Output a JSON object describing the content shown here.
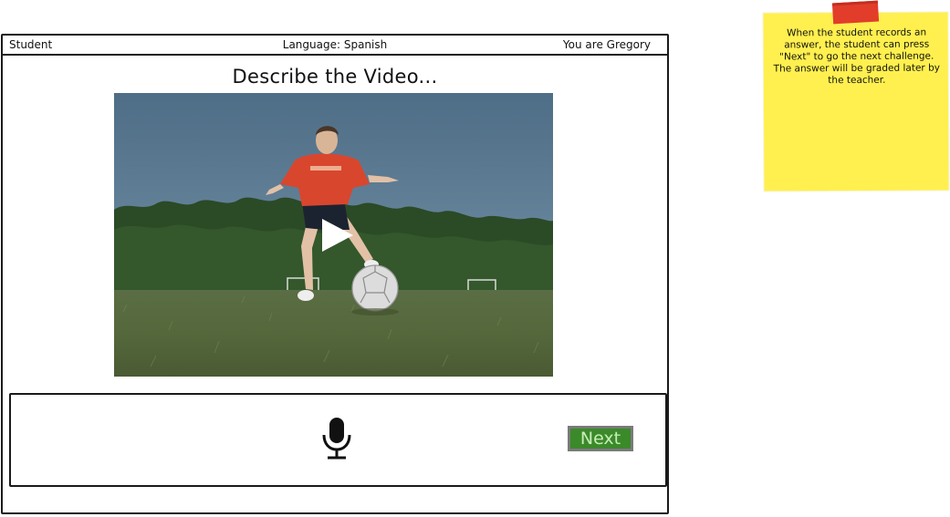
{
  "topbar": {
    "role": "Student",
    "language": "Language: Spanish",
    "user": "You are Gregory"
  },
  "main": {
    "heading": "Describe the Video..."
  },
  "video": {
    "play_icon": "play-icon",
    "scene": "soccer player kicking ball on grass field"
  },
  "recorder": {
    "mic_icon": "microphone-icon",
    "next_label": "Next"
  },
  "sticky_note": {
    "text": "When the student records an answer, the student can press \"Next\" to go the next challenge. The answer will be graded later by the teacher."
  },
  "colors": {
    "next_button_bg": "#3b8a2a",
    "next_button_text": "#c7ecb7",
    "sticky_bg": "#fff04f",
    "tape": "#e23d2b"
  }
}
